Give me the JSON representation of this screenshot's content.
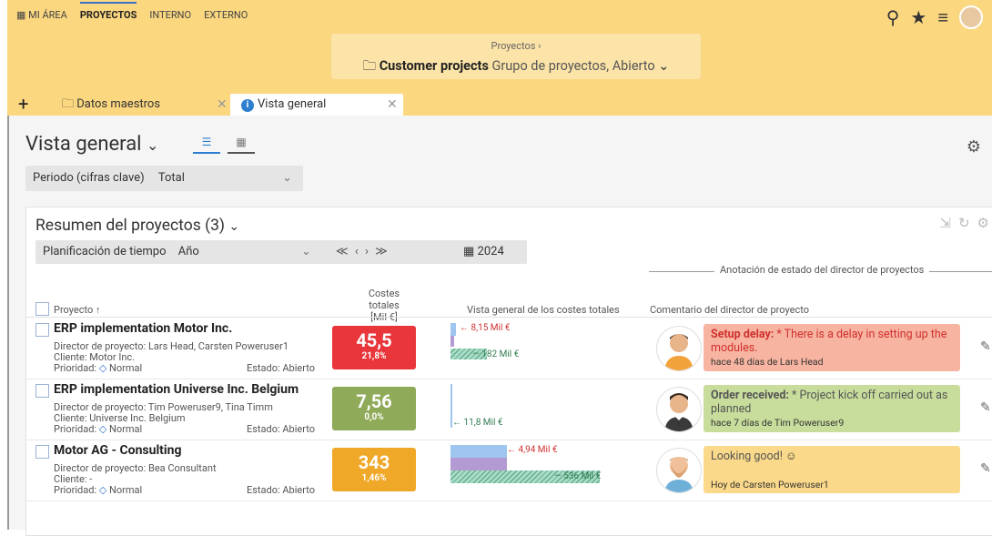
{
  "nav": {
    "my_area": "MI ÁREA",
    "projects": "PROYECTOS",
    "internal": "INTERNO",
    "external": "EXTERNO"
  },
  "crumb": {
    "parent": "Proyectos ›",
    "title": "Customer projects",
    "subtitle": "Grupo de proyectos, Abierto"
  },
  "tabs": [
    {
      "label": "Datos maestros"
    },
    {
      "label": "Vista general"
    }
  ],
  "page": {
    "title": "Vista general",
    "period_label": "Periodo (cifras clave)",
    "period_value": "Total"
  },
  "panel": {
    "title": "Resumen del proyectos (3)",
    "plan_label": "Planificación de tiempo",
    "plan_value": "Año",
    "year": "2024",
    "annotation_group": "Anotación de estado del director de proyectos",
    "col_project": "Proyecto",
    "col_costs_1": "Costes totales",
    "col_costs_2": "[Mil €]",
    "col_overview": "Vista general de los costes totales",
    "col_comment": "Comentario del director de proyecto"
  },
  "rows": [
    {
      "title": "ERP implementation Motor Inc.",
      "director": "Director de proyecto: Lars Head, Carsten Poweruser1",
      "client": "Cliente: Motor Inc.",
      "priority": "Prioridad:",
      "priority_value": "Normal",
      "state": "Estado: Abierto",
      "kpi_value": "45,5",
      "kpi_pct": "21,8%",
      "kpi_color": "#e8363b",
      "cost_a": "8,15 Mil €",
      "cost_b": "182 Mil €",
      "comment_title": "Setup delay:",
      "comment_text": " * There is a delay in setting up the modules.",
      "comment_meta": "hace 48 días de Lars Head",
      "comment_color": "#f7b4a0",
      "comment_title_color": "#d03030"
    },
    {
      "title": "ERP implementation Universe Inc. Belgium",
      "director": "Director de proyecto: Tim Poweruser9, Tina Timm",
      "client": "Cliente: Universe Inc. Belgium",
      "priority": "Prioridad:",
      "priority_value": "Normal",
      "state": "Estado: Abierto",
      "kpi_value": "7,56",
      "kpi_pct": "0,0%",
      "kpi_color": "#8faa58",
      "cost_a": "11,8 Mil €",
      "comment_title": "Order received:",
      "comment_text": " * Project kick off carried out as planned",
      "comment_meta": "hace 7 días de Tim Poweruser9",
      "comment_color": "#c8dd9c",
      "comment_title_color": "#555"
    },
    {
      "title": "Motor AG - Consulting",
      "director": "Director de proyecto: Bea Consultant",
      "client": "Cliente: -",
      "priority": "Prioridad:",
      "priority_value": "Normal",
      "state": "Estado: Abierto",
      "kpi_value": "343",
      "kpi_pct": "1,46%",
      "kpi_color": "#f0a828",
      "cost_a": "4,94 Mil €",
      "cost_b": "536 Mil €",
      "comment_title": "Looking good!",
      "comment_text": "",
      "comment_meta": "Hoy de Carsten Poweruser1",
      "comment_color": "#fbd98a",
      "comment_title_color": "#444"
    }
  ]
}
